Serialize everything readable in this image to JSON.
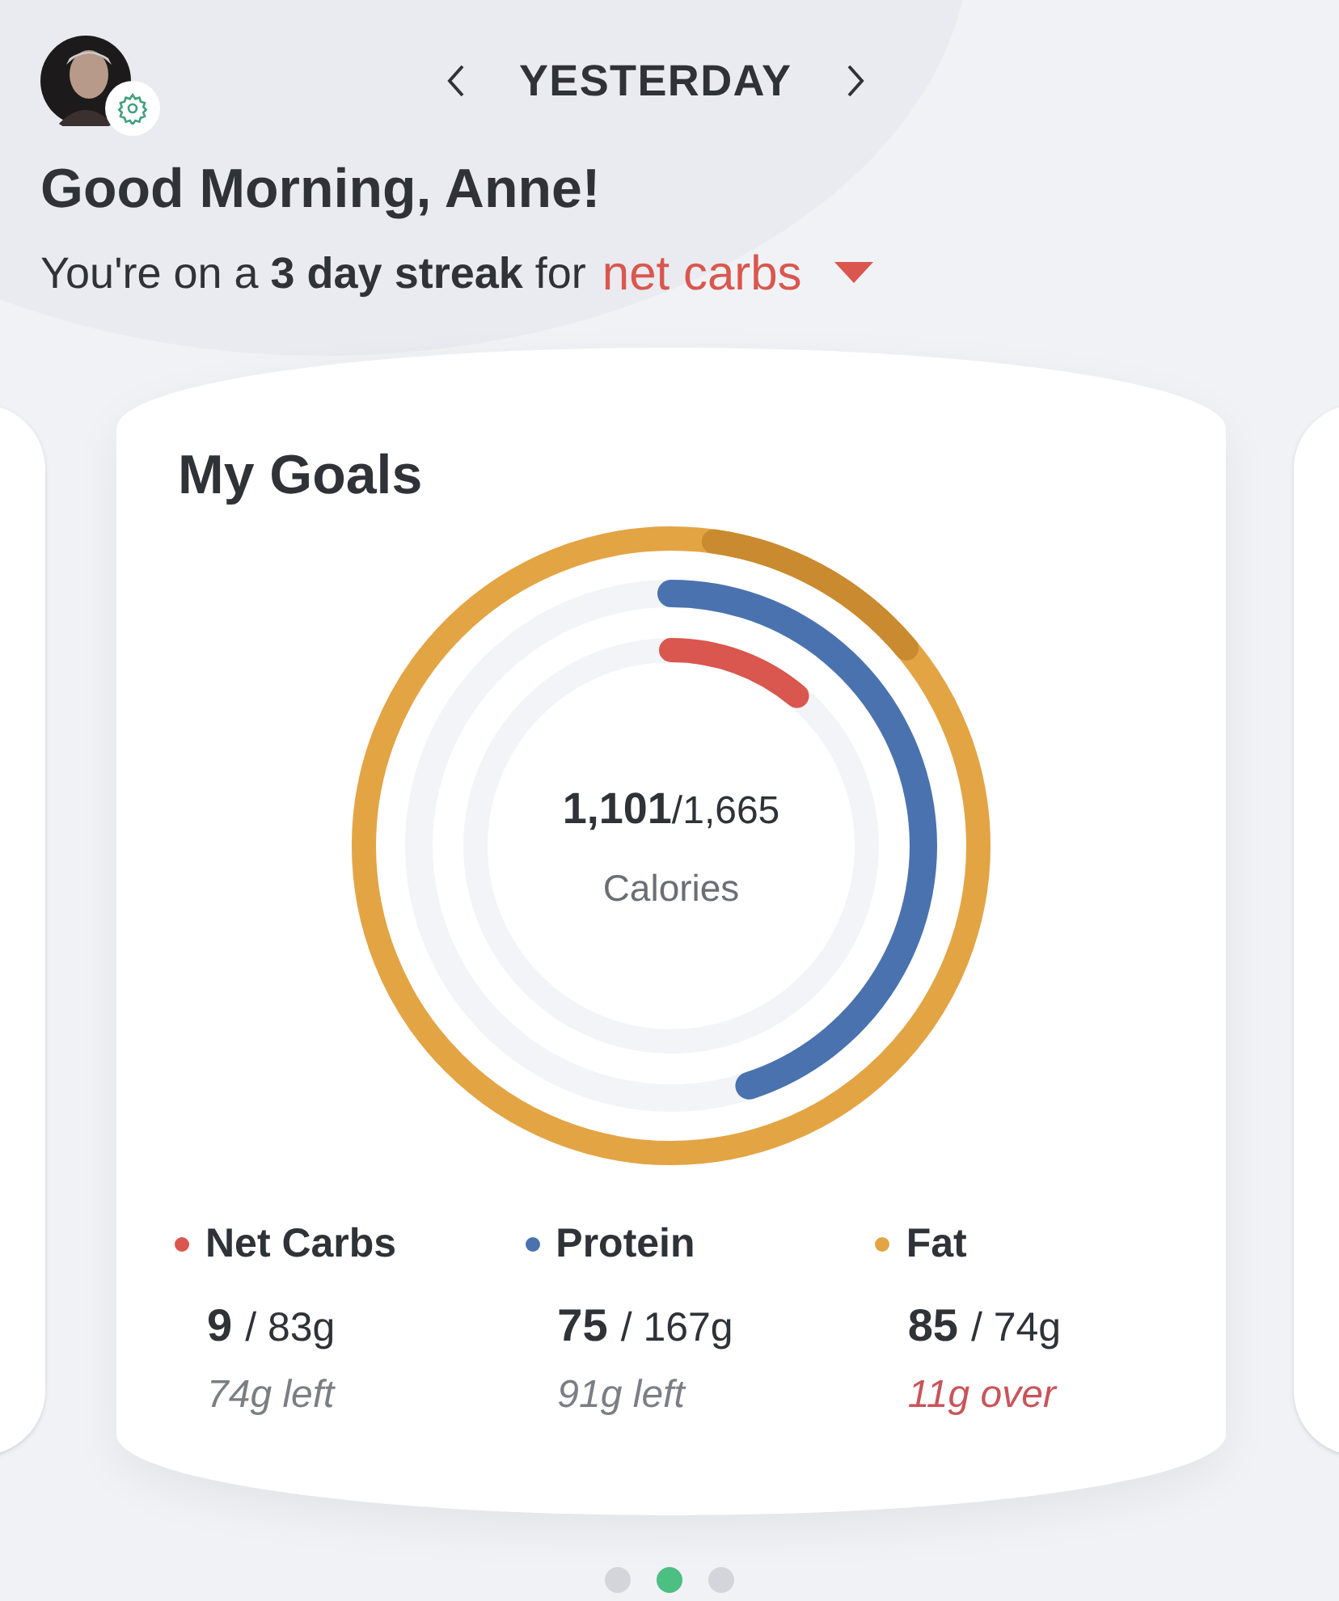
{
  "header": {
    "date_label": "YESTERDAY",
    "greeting": "Good Morning, Anne!",
    "streak_text": "You're on a **3 day streak** for",
    "streak_nutrient": "net carbs"
  },
  "card": {
    "title": "My Goals",
    "calories_eaten": "1,101",
    "calories_goal": "/1,665",
    "calories_label": "Calories",
    "macros": [
      {
        "name": "Net Carbs",
        "color": "#d9574e",
        "eaten": "9",
        "goal": "/ 83g",
        "remaining": "74g left",
        "over": false
      },
      {
        "name": "Protein",
        "color": "#4a72ae",
        "eaten": "75",
        "goal": "/ 167g",
        "remaining": "91g left",
        "over": false
      },
      {
        "name": "Fat",
        "color": "#e3a444",
        "eaten": "85",
        "goal": "/ 74g",
        "remaining": "11g over",
        "over": true
      }
    ]
  },
  "pager": [
    {
      "selected": false
    },
    {
      "selected": true
    },
    {
      "selected": false
    }
  ]
}
